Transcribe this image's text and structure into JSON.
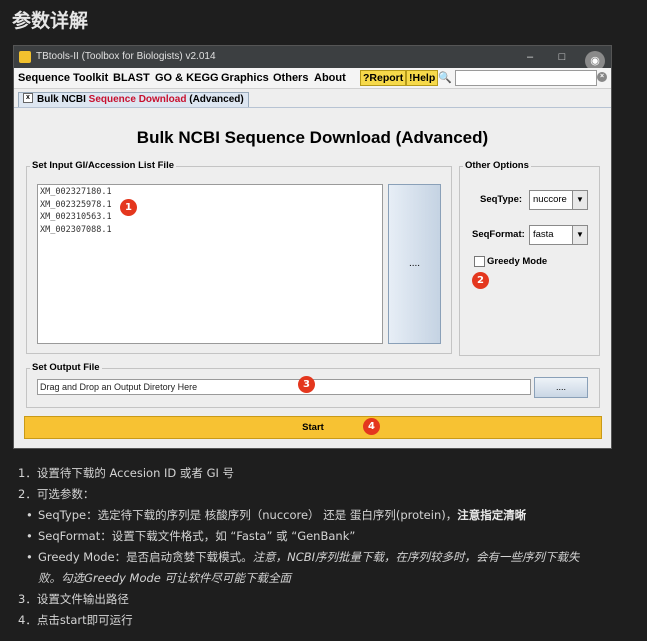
{
  "heading": "参数详解",
  "window": {
    "title": "TBtools-II (Toolbox for Biologists) v2.014",
    "minimize_glyph": "–",
    "maximize_glyph": "□",
    "menu": {
      "items": [
        "Sequence Toolkit",
        "BLAST",
        "GO & KEGG",
        "Graphics",
        "Others",
        "About"
      ],
      "report_label": "?Report",
      "help_label": "!Help",
      "search_glyph": "🔍",
      "search_value": ""
    },
    "tab": {
      "label_prefix": "Bulk NCBI ",
      "label_red": "Sequence Download",
      "label_suffix": " (Advanced)",
      "close_glyph": "x"
    },
    "main_title": "Bulk NCBI Sequence Download (Advanced)",
    "input_group": {
      "label": "Set Input GI/Accession List File",
      "accessions": [
        "XM_002327180.1",
        "XM_002325978.1",
        "XM_002310563.1",
        "XM_002307088.1"
      ],
      "browse_label": "...."
    },
    "options_group": {
      "label": "Other Options",
      "seqtype_label": "SeqType:",
      "seqtype_value": "nuccore",
      "seqformat_label": "SeqFormat:",
      "seqformat_value": "fasta",
      "greedy_label": "Greedy Mode",
      "greedy_checked": false,
      "arrow_glyph": "▼"
    },
    "output_group": {
      "label": "Set Output File",
      "placeholder": "Drag and Drop an Output Diretory Here",
      "browse_label": "...."
    },
    "start_label": "Start",
    "badges": [
      "1",
      "2",
      "3",
      "4"
    ]
  },
  "notes": {
    "n1": "1．设置待下载的 Accesion ID 或者 GI 号",
    "n2": "2．可选参数：",
    "bullet": "•",
    "s1_a": "SeqType：选定待下载的序列是 核酸序列（nuccore） 还是 蛋白序列(protein)，",
    "s1_b": "注意指定清晰",
    "s2": "SeqFormat：设置下载文件格式，如 “Fasta” 或 “GenBank”",
    "s3_a": "Greedy Mode：是否启动贪婪下载模式。",
    "s3_b": "注意，NCBI序列批量下载，在序列较多时，会有一些序列下载失",
    "s3_c": "败。勾选Greedy Mode 可让软件尽可能下载全面",
    "n3": "3．设置文件输出路径",
    "n4": "4．点击start即可运行"
  }
}
